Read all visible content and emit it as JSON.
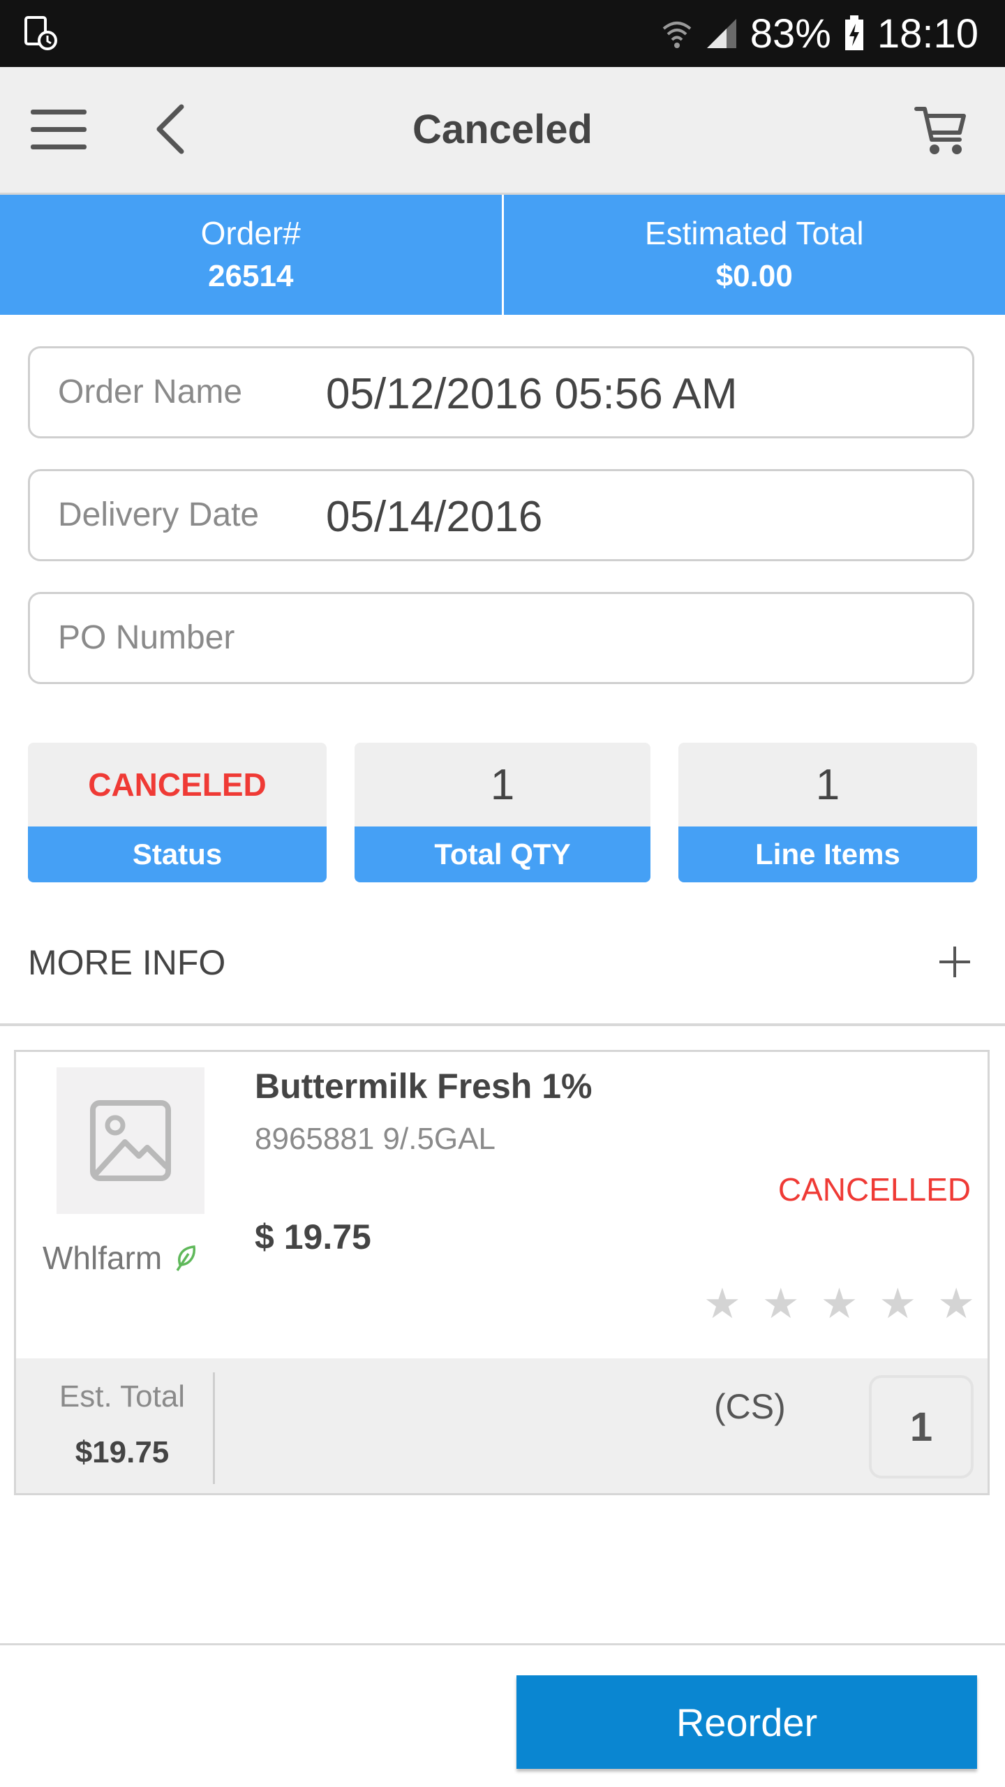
{
  "status_bar": {
    "battery": "83%",
    "time": "18:10"
  },
  "app_bar": {
    "title": "Canceled"
  },
  "summary": {
    "order_label": "Order#",
    "order_value": "26514",
    "total_label": "Estimated Total",
    "total_value": "$0.00"
  },
  "fields": {
    "order_name_label": "Order Name",
    "order_name_value": "05/12/2016 05:56 AM",
    "delivery_date_label": "Delivery Date",
    "delivery_date_value": "05/14/2016",
    "po_number_placeholder": "PO Number"
  },
  "stats": {
    "status_value": "CANCELED",
    "status_label": "Status",
    "total_qty_value": "1",
    "total_qty_label": "Total QTY",
    "line_items_value": "1",
    "line_items_label": "Line Items"
  },
  "more_info": {
    "label": "MORE INFO",
    "expand_icon": "plus-icon"
  },
  "product": {
    "name": "Buttermilk Fresh 1%",
    "code": "8965881 9/.5GAL",
    "status": "CANCELLED",
    "price": "$ 19.75",
    "brand": "Whlfarm",
    "rating": 0,
    "rating_max": 5,
    "est_total_label": "Est. Total",
    "est_total_value": "$19.75",
    "unit": "(CS)",
    "quantity": "1"
  },
  "actions": {
    "reorder_label": "Reorder"
  },
  "colors": {
    "accent_blue": "#45a0f5",
    "button_blue": "#0a86d1",
    "status_red": "#ef3a35"
  }
}
